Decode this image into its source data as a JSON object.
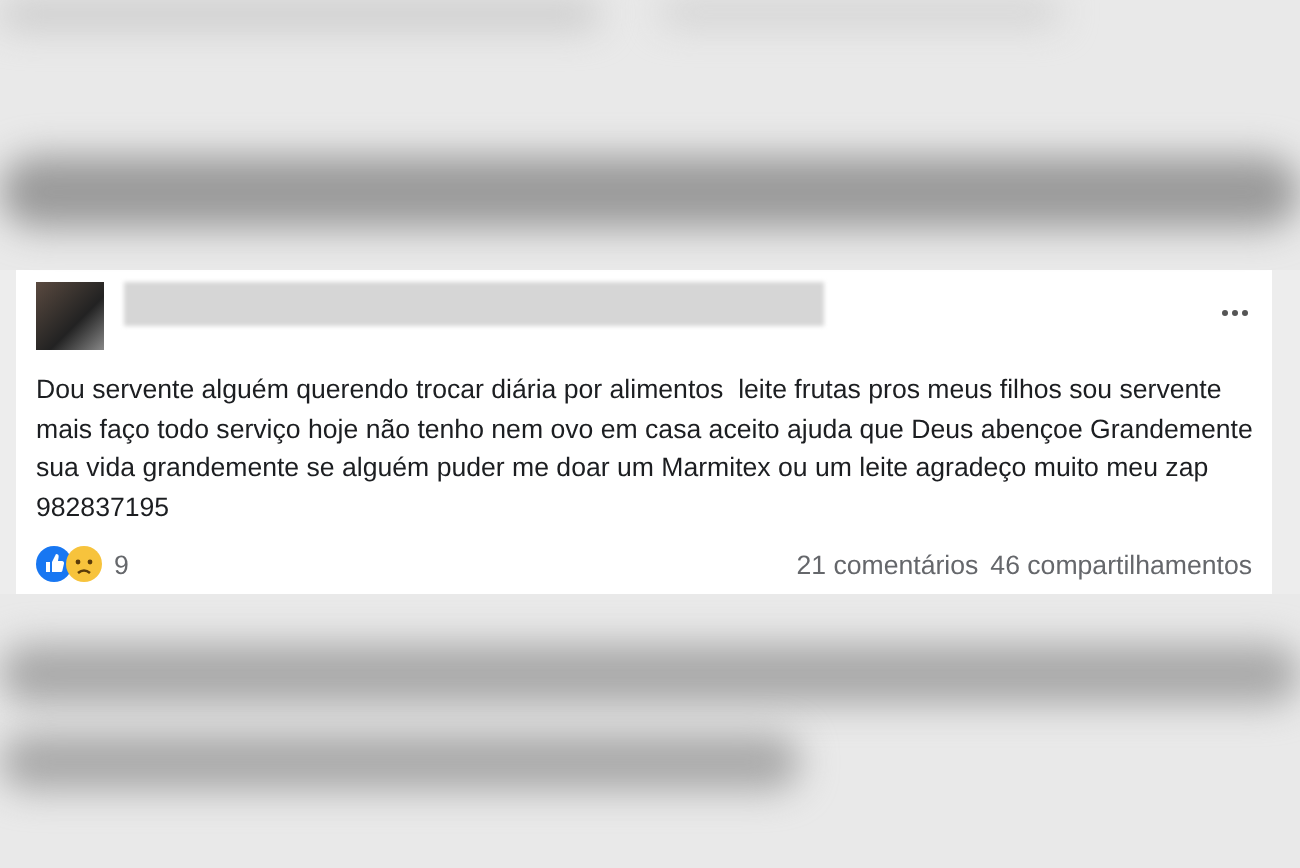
{
  "post": {
    "text": "Dou servente alguém querendo trocar diária por alimentos  leite frutas pros meus filhos sou servente mais faço todo serviço hoje não tenho nem ovo em casa aceito ajuda que Deus abençoe Grandemente sua vida grandemente se alguém puder me doar um Marmitex ou um leite agradeço muito meu zap 982837195",
    "reactions": [
      {
        "kind": "like"
      },
      {
        "kind": "sad"
      }
    ],
    "reaction_count": "9",
    "comments": "21 comentários",
    "shares": "46 compartilhamentos"
  }
}
